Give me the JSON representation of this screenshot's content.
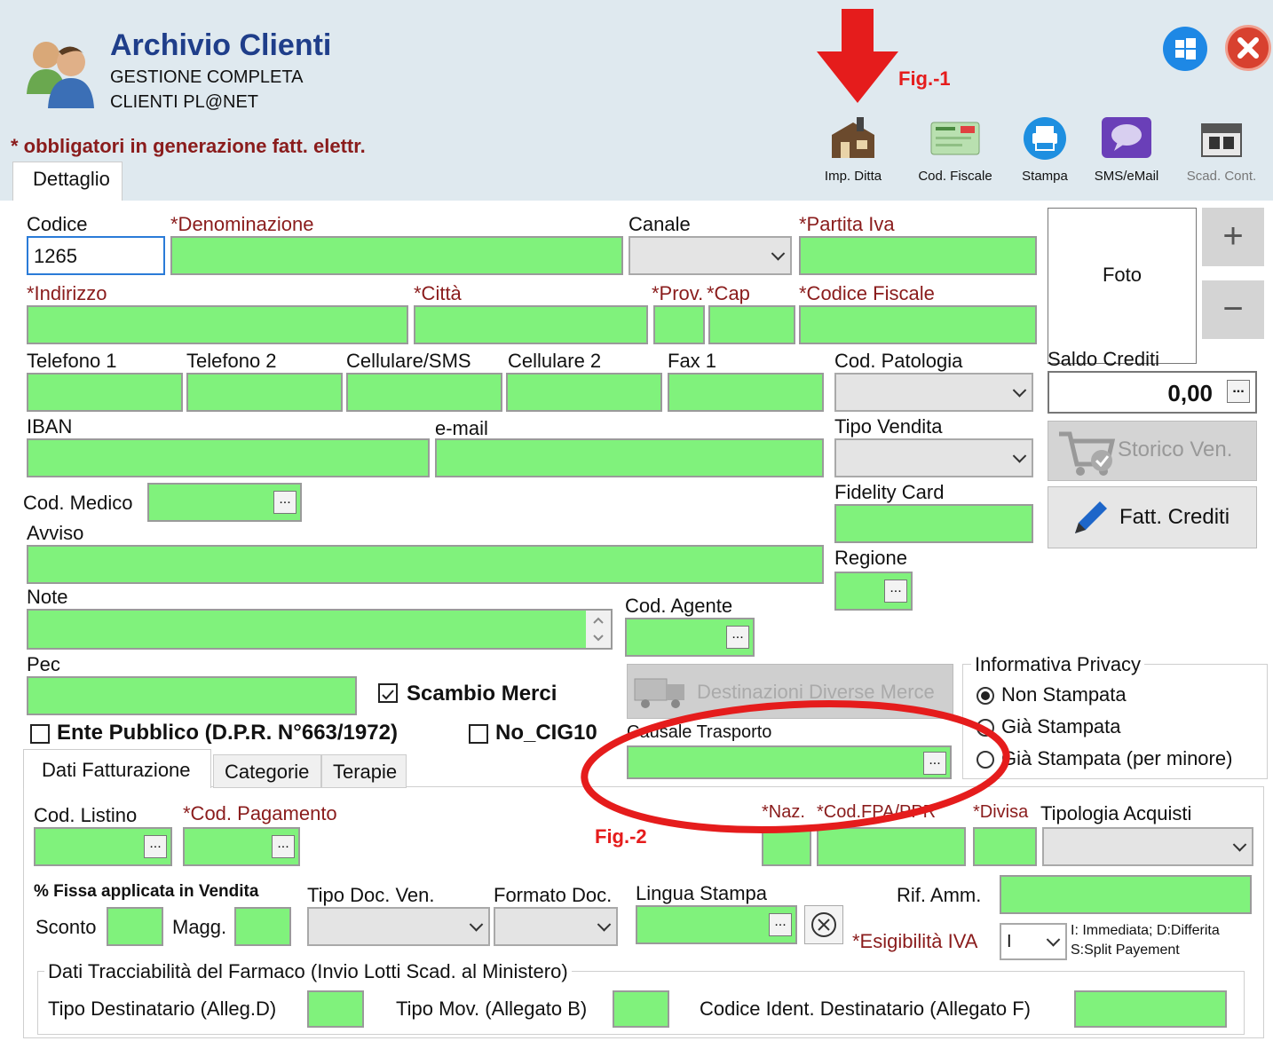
{
  "app": {
    "title": "Archivio Clienti",
    "subtitle1": "GESTIONE COMPLETA",
    "subtitle2": "CLIENTI PL@NET"
  },
  "annotations": {
    "fig1": "Fig.-1",
    "fig2": "Fig.-2"
  },
  "required_note": "* obbligatori in generazione fatt. elettr.",
  "toolbar": {
    "imp_ditta": "Imp. Ditta",
    "cod_fiscale": "Cod. Fiscale",
    "stampa": "Stampa",
    "sms_email": "SMS/eMail",
    "scad_cont": "Scad. Cont."
  },
  "tabs": {
    "dettaglio": "Dettaglio"
  },
  "fields": {
    "codice": {
      "label": "Codice",
      "value": "1265"
    },
    "denominazione": "*Denominazione",
    "canale": "Canale",
    "partita_iva": "*Partita Iva",
    "indirizzo": "*Indirizzo",
    "citta": "*Città",
    "prov": "*Prov.",
    "cap": "*Cap",
    "codice_fiscale": "*Codice Fiscale",
    "telefono1": "Telefono 1",
    "telefono2": "Telefono 2",
    "cellulare_sms": "Cellulare/SMS",
    "cellulare2": "Cellulare 2",
    "fax1": "Fax 1",
    "cod_patologia": "Cod. Patologia",
    "iban": "IBAN",
    "email": "e-mail",
    "tipo_vendita": "Tipo Vendita",
    "cod_medico": "Cod. Medico",
    "fidelity_card": "Fidelity Card",
    "avviso": "Avviso",
    "regione": "Regione",
    "note": "Note",
    "cod_agente": "Cod. Agente",
    "pec": "Pec",
    "causale_trasporto": "Causale Trasporto"
  },
  "foto": {
    "label": "Foto",
    "plus": "+",
    "minus": "−"
  },
  "saldo": {
    "label": "Saldo Crediti",
    "value": "0,00",
    "dots": "..."
  },
  "buttons": {
    "storico_ven": "Storico Ven.",
    "fatt_crediti": "Fatt. Crediti",
    "destinazioni": "Destinazioni Diverse Merce",
    "dots": "..."
  },
  "checks": {
    "scambio_merci": "Scambio Merci",
    "ente_pubblico": "Ente Pubblico (D.P.R. N°663/1972)",
    "no_cig": "No_CIG10"
  },
  "privacy": {
    "legend": "Informativa Privacy",
    "options": [
      "Non Stampata",
      "Già Stampata",
      "Già Stampata (per minore)"
    ],
    "selected": 0
  },
  "subtabs": [
    "Dati Fatturazione",
    "Categorie",
    "Terapie"
  ],
  "fatt": {
    "cod_listino": "Cod. Listino",
    "cod_pagamento": "*Cod. Pagamento",
    "naz": "*Naz.",
    "cod_fpa": "*Cod.FPA/PPR",
    "divisa": "*Divisa",
    "tipologia_acquisti": "Tipologia Acquisti",
    "fissa": "% Fissa applicata in Vendita",
    "sconto": "Sconto",
    "magg": "Magg.",
    "tipo_doc_ven": "Tipo Doc. Ven.",
    "formato_doc": "Formato Doc.",
    "lingua_stampa": "Lingua Stampa",
    "rif_amm": "Rif. Amm.",
    "esigibilita": "*Esigibilità IVA",
    "esigibilita_value": "I",
    "esig_hint1": "I: Immediata; D:Differita",
    "esig_hint2": "S:Split Payement"
  },
  "tracc": {
    "legend": "Dati Tracciabilità del Farmaco (Invio Lotti Scad. al Ministero)",
    "tipo_dest": "Tipo Destinatario (Alleg.D)",
    "tipo_mov": "Tipo Mov. (Allegato B)",
    "codice_ident": "Codice Ident. Destinatario (Allegato F)"
  },
  "colors": {
    "field_green": "#80f27c",
    "required_red": "#8a1c1c",
    "title_blue": "#1f3e8a",
    "arrow_red": "#e51c1c"
  }
}
